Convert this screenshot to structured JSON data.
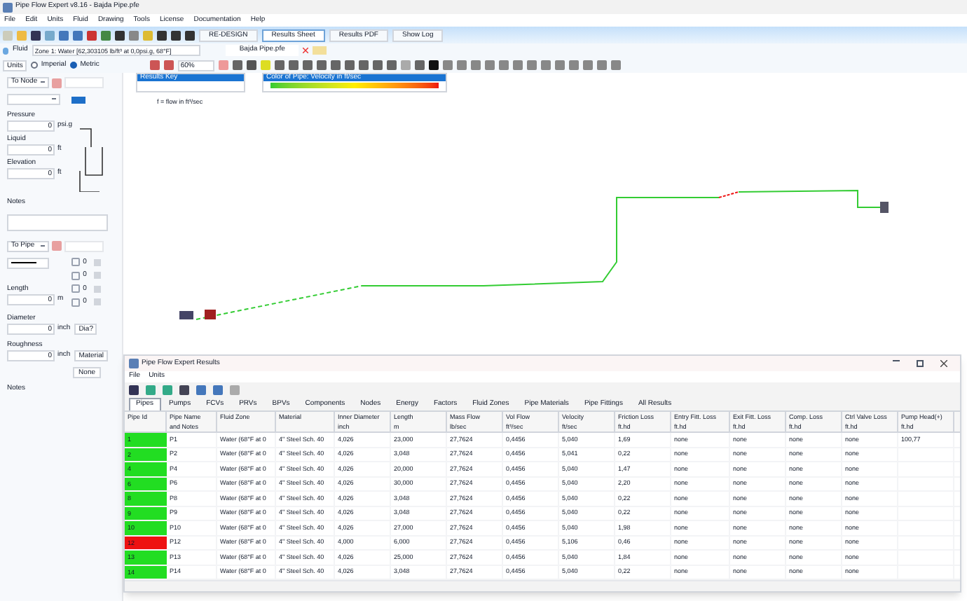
{
  "window": {
    "title": "Pipe Flow Expert v8.16 - Bajda Pipe.pfe"
  },
  "menu": [
    "File",
    "Edit",
    "Units",
    "Fluid",
    "Drawing",
    "Tools",
    "License",
    "Documentation",
    "Help"
  ],
  "toolbar_buttons": [
    "RE-DESIGN",
    "Results Sheet",
    "Results PDF",
    "Show Log"
  ],
  "fluid_bar": {
    "label": "Fluid",
    "zone": "Zone 1: Water [62,303105 lb/ft³ at 0,0psi.g, 68°F]",
    "file_tab": "Bajda Pipe.pfe"
  },
  "units_bar": {
    "label": "Units",
    "options": [
      {
        "label": "Imperial",
        "selected": false
      },
      {
        "label": "Metric",
        "selected": true
      }
    ],
    "zoom": "60%"
  },
  "results_key": {
    "title": "Results Key",
    "text": "f = flow in ft³/sec"
  },
  "color_key": {
    "title": "Color of Pipe: Velocity in ft/sec"
  },
  "node_panel": {
    "selector": "To Node",
    "pressure": {
      "label": "Pressure",
      "value": "0",
      "unit": "psi.g"
    },
    "liquid": {
      "label": "Liquid",
      "value": "0",
      "unit": "ft"
    },
    "elevation": {
      "label": "Elevation",
      "value": "0",
      "unit": "ft"
    },
    "notes_label": "Notes"
  },
  "pipe_panel": {
    "selector": "To Pipe",
    "length": {
      "label": "Length",
      "value": "0",
      "unit": "m"
    },
    "diameter": {
      "label": "Diameter",
      "value": "0",
      "unit": "inch",
      "button": "Dia?"
    },
    "roughness": {
      "label": "Roughness",
      "value": "0",
      "unit": "inch",
      "button": "Material"
    },
    "none_button": "None",
    "notes_label": "Notes",
    "counters": [
      "0",
      "0",
      "0",
      "0"
    ]
  },
  "results_window": {
    "title": "Pipe Flow Expert  Results",
    "menu": [
      "File",
      "Units"
    ],
    "tabs": [
      {
        "label": "Pipes",
        "selected": true
      },
      {
        "label": "Pumps",
        "selected": false
      },
      {
        "label": "FCVs",
        "selected": false
      },
      {
        "label": "PRVs",
        "selected": false
      },
      {
        "label": "BPVs",
        "selected": false
      },
      {
        "label": "Components",
        "selected": false
      },
      {
        "label": "Nodes",
        "selected": false
      },
      {
        "label": "Energy",
        "selected": false
      },
      {
        "label": "Factors",
        "selected": false
      },
      {
        "label": "Fluid Zones",
        "selected": false
      },
      {
        "label": "Pipe Materials",
        "selected": false
      },
      {
        "label": "Pipe Fittings",
        "selected": false
      },
      {
        "label": "All Results",
        "selected": false
      }
    ],
    "columns": [
      {
        "name": "Pipe Id"
      },
      {
        "name": "Pipe Name",
        "unit": "and Notes"
      },
      {
        "name": "Fluid Zone"
      },
      {
        "name": "Material"
      },
      {
        "name": "Inner Diameter",
        "unit": "inch"
      },
      {
        "name": "Length",
        "unit": "m"
      },
      {
        "name": "Mass Flow",
        "unit": "lb/sec"
      },
      {
        "name": "Vol Flow",
        "unit": "ft³/sec"
      },
      {
        "name": "Velocity",
        "unit": "ft/sec"
      },
      {
        "name": "Friction Loss",
        "unit": "ft.hd"
      },
      {
        "name": "Entry Fitt. Loss",
        "unit": "ft.hd"
      },
      {
        "name": "Exit Fitt. Loss",
        "unit": "ft.hd"
      },
      {
        "name": "Comp. Loss",
        "unit": "ft.hd"
      },
      {
        "name": "Ctrl Valve Loss",
        "unit": "ft.hd"
      },
      {
        "name": "Pump Head(+)",
        "unit": "ft.hd"
      }
    ],
    "rows": [
      {
        "color": "#22dd22",
        "cells": [
          "1",
          "P1",
          "Water (68°F at 0",
          "4\" Steel Sch. 40",
          "4,026",
          "23,000",
          "27,7624",
          "0,4456",
          "5,040",
          "1,69",
          "none",
          "none",
          "none",
          "none",
          "100,77"
        ]
      },
      {
        "color": "#22dd22",
        "cells": [
          "2",
          "P2",
          "Water (68°F at 0",
          "4\" Steel Sch. 40",
          "4,026",
          "3,048",
          "27,7624",
          "0,4456",
          "5,041",
          "0,22",
          "none",
          "none",
          "none",
          "none"
        ]
      },
      {
        "color": "#22dd22",
        "cells": [
          "4",
          "P4",
          "Water (68°F at 0",
          "4\" Steel Sch. 40",
          "4,026",
          "20,000",
          "27,7624",
          "0,4456",
          "5,040",
          "1,47",
          "none",
          "none",
          "none",
          "none"
        ]
      },
      {
        "color": "#22dd22",
        "cells": [
          "6",
          "P6",
          "Water (68°F at 0",
          "4\" Steel Sch. 40",
          "4,026",
          "30,000",
          "27,7624",
          "0,4456",
          "5,040",
          "2,20",
          "none",
          "none",
          "none",
          "none"
        ]
      },
      {
        "color": "#22dd22",
        "cells": [
          "8",
          "P8",
          "Water (68°F at 0",
          "4\" Steel Sch. 40",
          "4,026",
          "3,048",
          "27,7624",
          "0,4456",
          "5,040",
          "0,22",
          "none",
          "none",
          "none",
          "none"
        ]
      },
      {
        "color": "#22dd22",
        "cells": [
          "9",
          "P9",
          "Water (68°F at 0",
          "4\" Steel Sch. 40",
          "4,026",
          "3,048",
          "27,7624",
          "0,4456",
          "5,040",
          "0,22",
          "none",
          "none",
          "none",
          "none"
        ]
      },
      {
        "color": "#22dd22",
        "cells": [
          "10",
          "P10",
          "Water (68°F at 0",
          "4\" Steel Sch. 40",
          "4,026",
          "27,000",
          "27,7624",
          "0,4456",
          "5,040",
          "1,98",
          "none",
          "none",
          "none",
          "none"
        ]
      },
      {
        "color": "#ee1111",
        "cells": [
          "12",
          "P12",
          "Water (68°F at 0",
          "4\" Steel Sch. 40",
          "4,000",
          "6,000",
          "27,7624",
          "0,4456",
          "5,106",
          "0,46",
          "none",
          "none",
          "none",
          "none"
        ]
      },
      {
        "color": "#22dd22",
        "cells": [
          "13",
          "P13",
          "Water (68°F at 0",
          "4\" Steel Sch. 40",
          "4,026",
          "25,000",
          "27,7624",
          "0,4456",
          "5,040",
          "1,84",
          "none",
          "none",
          "none",
          "none"
        ]
      },
      {
        "color": "#22dd22",
        "cells": [
          "14",
          "P14",
          "Water (68°F at 0",
          "4\" Steel Sch. 40",
          "4,026",
          "3,048",
          "27,7624",
          "0,4456",
          "5,040",
          "0,22",
          "none",
          "none",
          "none",
          "none"
        ]
      }
    ]
  }
}
